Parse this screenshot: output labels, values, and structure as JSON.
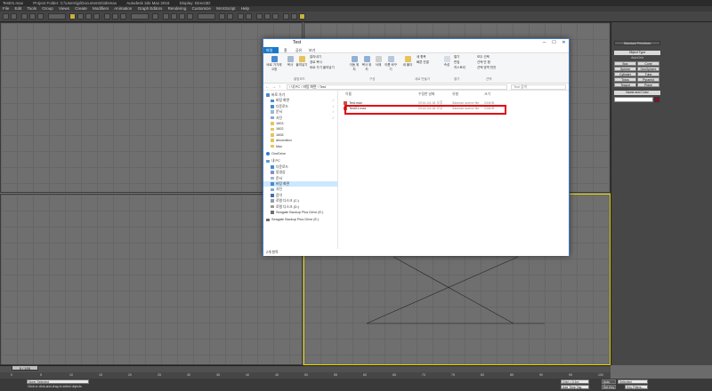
{
  "app": {
    "title_parts": [
      "Test01.max",
      "Project Folder: C:\\Users\\jp\\Documents\\3dsmax",
      "Autodesk 3ds Max 2016",
      "Display: Direct3D"
    ],
    "menu": [
      "File",
      "Edit",
      "Tools",
      "Group",
      "Views",
      "Create",
      "Modifiers",
      "Animation",
      "Graph Editors",
      "Rendering",
      "Customize",
      "MAXScript",
      "Help"
    ],
    "viewports": {
      "top_label": "",
      "active_color": "#e8d600"
    },
    "command_panel": {
      "dropdown": "Standard Primitives",
      "object_type_header": "Object Type",
      "autogrid": "AutoGrid",
      "buttons": [
        "Box",
        "Cone",
        "Sphere",
        "GeoSphere",
        "Cylinder",
        "Tube",
        "Torus",
        "Pyramid",
        "Teapot",
        "Plane"
      ],
      "name_color_header": "Name and Color"
    },
    "timeline": {
      "slider": "0 / 100",
      "ticks": [
        "0",
        "5",
        "10",
        "15",
        "20",
        "25",
        "30",
        "35",
        "40",
        "45",
        "50",
        "55",
        "60",
        "65",
        "70",
        "75",
        "80",
        "85",
        "90",
        "95",
        "100"
      ]
    },
    "status": {
      "selection": "None Selected",
      "prompt": "Click or click-and-drag to select objects",
      "grid": "Grid = 0.1m",
      "add_time_tag": "Add Time Tag",
      "auto_key": "Auto Key",
      "set_key": "Set Key",
      "selected": "Selected",
      "key_filters": "Key Filters..."
    }
  },
  "explorer": {
    "title": "Test",
    "tabs": [
      "파일",
      "홈",
      "공유",
      "보기"
    ],
    "ribbon": {
      "items": [
        "바로 가기에 고정",
        "복사",
        "붙여넣기",
        "잘라내기",
        "경로 복사",
        "바로 가기 붙여넣기",
        "이동 위치",
        "복사 위치",
        "삭제",
        "이름 바꾸기",
        "새 폴더",
        "새 항목",
        "빠른 연결",
        "속성",
        "열기",
        "편집",
        "히스토리",
        "모두 선택",
        "선택 안 함",
        "선택 영역 반전"
      ],
      "groups": [
        "클립보드",
        "구성",
        "새로 만들기",
        "열기",
        "선택"
      ]
    },
    "address": "› 내 PC › 바탕 화면 › Test",
    "search_placeholder": "Test 검색",
    "nav": [
      {
        "label": "바로 가기",
        "pin": ""
      },
      {
        "label": "바탕 화면",
        "pin": "✓"
      },
      {
        "label": "다운로드",
        "pin": "✓"
      },
      {
        "label": "문서",
        "pin": "✓"
      },
      {
        "label": "사진",
        "pin": "✓"
      },
      {
        "label": "1603",
        "pin": ""
      },
      {
        "label": "1602",
        "pin": ""
      },
      {
        "label": "1608",
        "pin": ""
      },
      {
        "label": "decoration",
        "pin": ""
      },
      {
        "label": "Max",
        "pin": ""
      },
      {
        "label": "OneDrive",
        "pin": ""
      },
      {
        "label": "내 PC",
        "pin": ""
      },
      {
        "label": "다운로드",
        "pin": ""
      },
      {
        "label": "동영상",
        "pin": ""
      },
      {
        "label": "문서",
        "pin": ""
      },
      {
        "label": "바탕 화면",
        "pin": ""
      },
      {
        "label": "사진",
        "pin": ""
      },
      {
        "label": "음악",
        "pin": ""
      },
      {
        "label": "로컬 디스크 (C:)",
        "pin": ""
      },
      {
        "label": "로컬 디스크 (D:)",
        "pin": ""
      },
      {
        "label": "Seagate Backup Plus Drive (E:)",
        "pin": ""
      },
      {
        "label": "Seagate Backup Plus Drive (E:)",
        "pin": ""
      }
    ],
    "columns": [
      "이름",
      "수정한 날짜",
      "유형",
      "크기"
    ],
    "files": [
      {
        "name": "Test.max",
        "date": "2016-04-18 오후",
        "type": "3dsmax scene file",
        "size": "244KB"
      },
      {
        "name": "Test01.max",
        "date": "2016-04-18 오후",
        "type": "3dsmax scene file",
        "size": "228KB"
      }
    ],
    "status": "2개 항목"
  }
}
